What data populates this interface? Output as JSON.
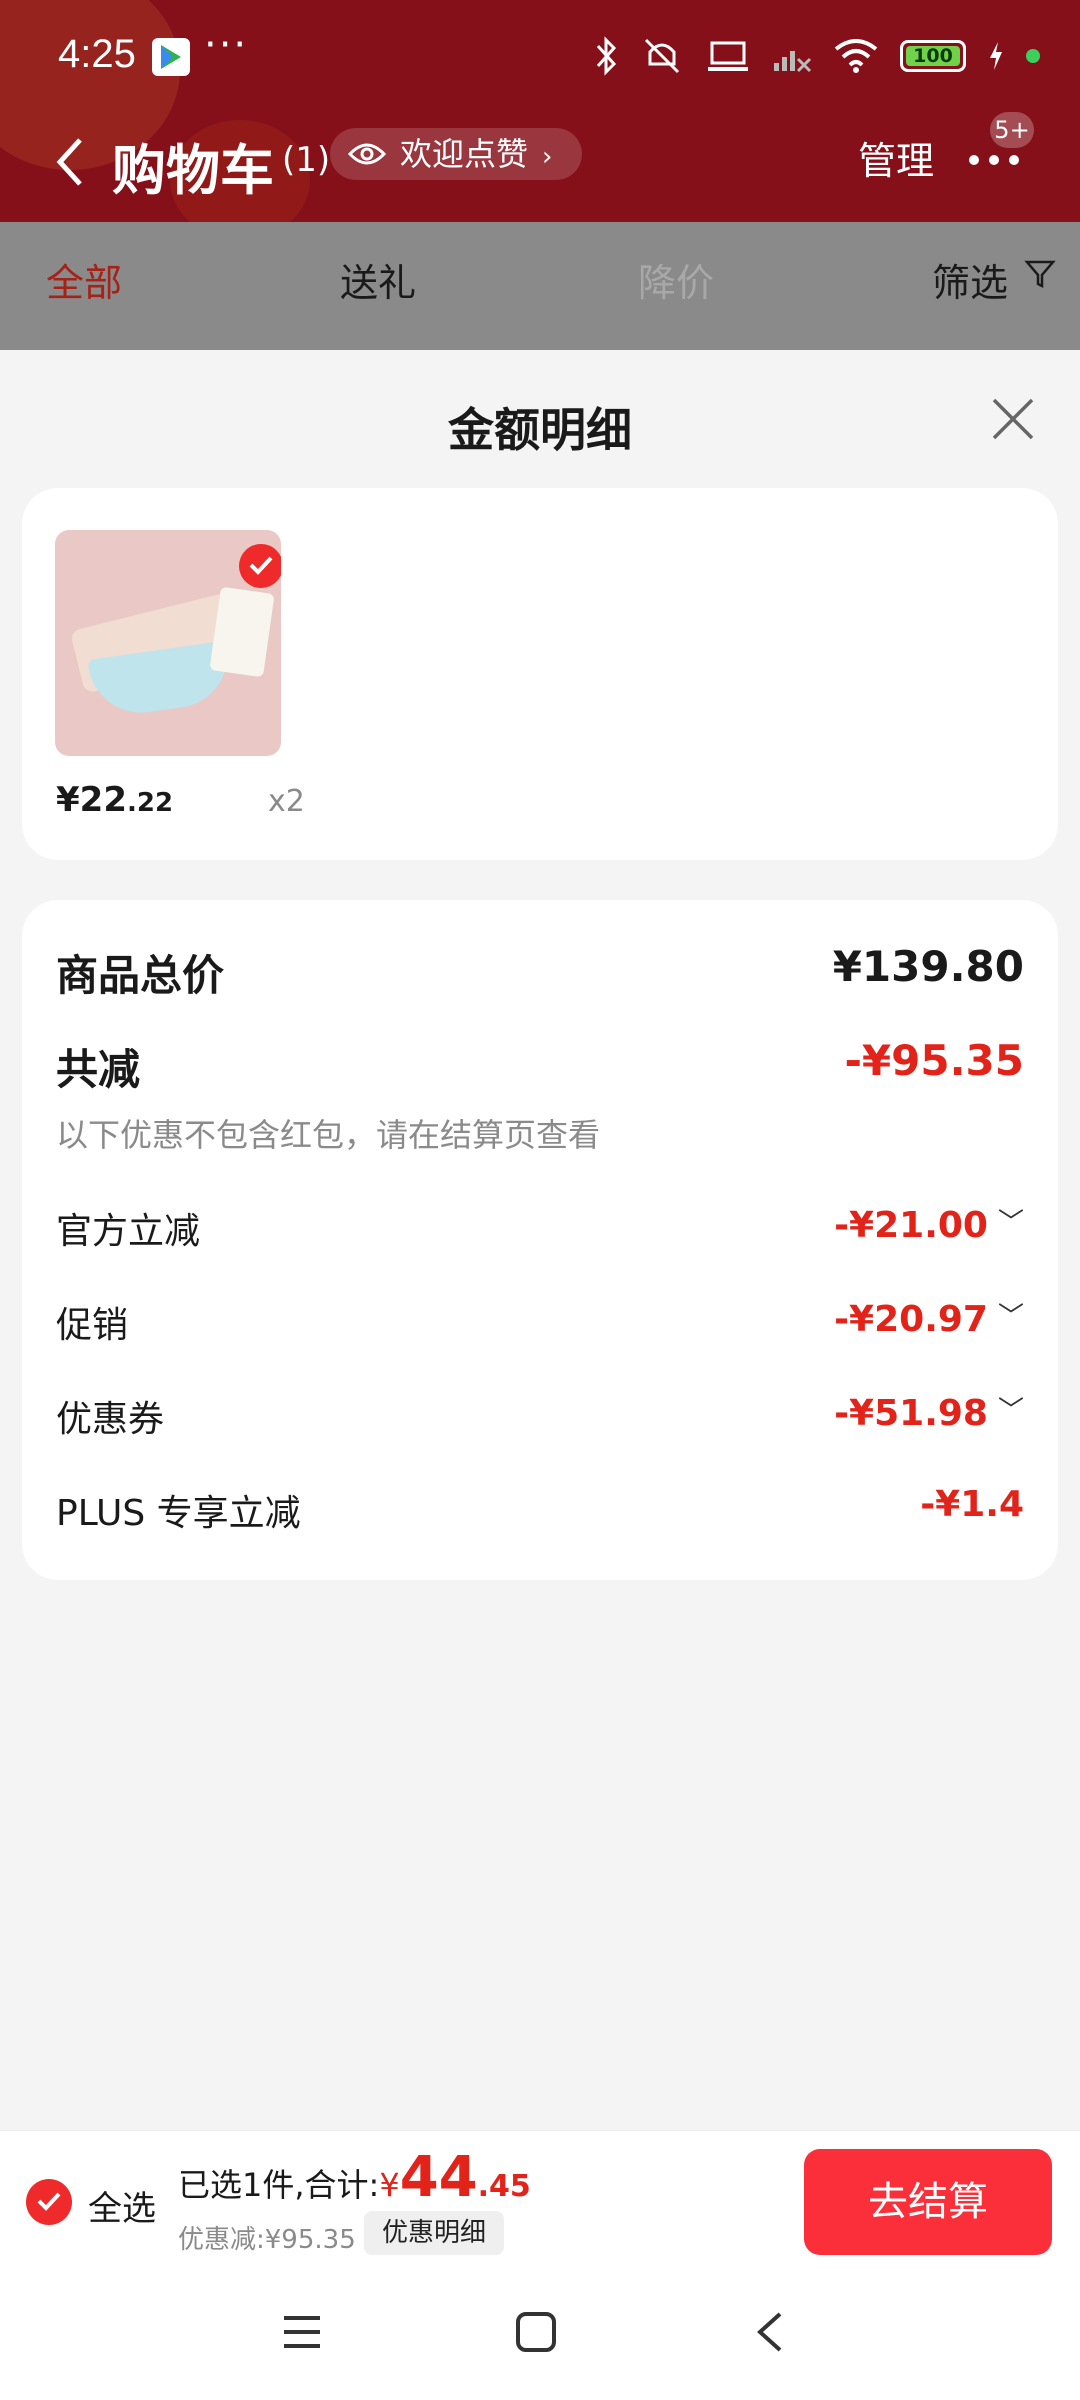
{
  "status_bar": {
    "time": "4:25",
    "more": "···",
    "battery": "100"
  },
  "nav": {
    "title": "购物车",
    "count": "(1)",
    "welcome": "欢迎点赞",
    "manage": "管理",
    "badge": "5+"
  },
  "tabs": {
    "all": "全部",
    "gift": "送礼",
    "price_drop": "降价",
    "filter": "筛选"
  },
  "sheet": {
    "title": "金额明细"
  },
  "product": {
    "price_currency": "¥",
    "price_int": "22",
    "price_dec": ".22",
    "qty": "x2"
  },
  "details": {
    "total_label": "商品总价",
    "total_value": "¥139.80",
    "reduce_label": "共减",
    "reduce_value": "-¥95.35",
    "note": "以下优惠不包含红包，请在结算页查看",
    "items": [
      {
        "label": "官方立减",
        "value": "-¥21.00"
      },
      {
        "label": "促销",
        "value": "-¥20.97"
      },
      {
        "label": "优惠券",
        "value": "-¥51.98"
      },
      {
        "label": "PLUS 专享立减",
        "value": "-¥1.4"
      }
    ]
  },
  "checkout": {
    "select_all": "全选",
    "selected_text": "已选1件,合计:",
    "currency": "¥",
    "total_int": "44",
    "total_dec": ".45",
    "discount_text": "优惠减:¥95.35",
    "detail_chip": "优惠明细",
    "checkout_button": "去结算"
  },
  "colors": {
    "accent_red": "#e2231a",
    "button_red": "#fb2f3a",
    "header_bg": "#86101a"
  }
}
